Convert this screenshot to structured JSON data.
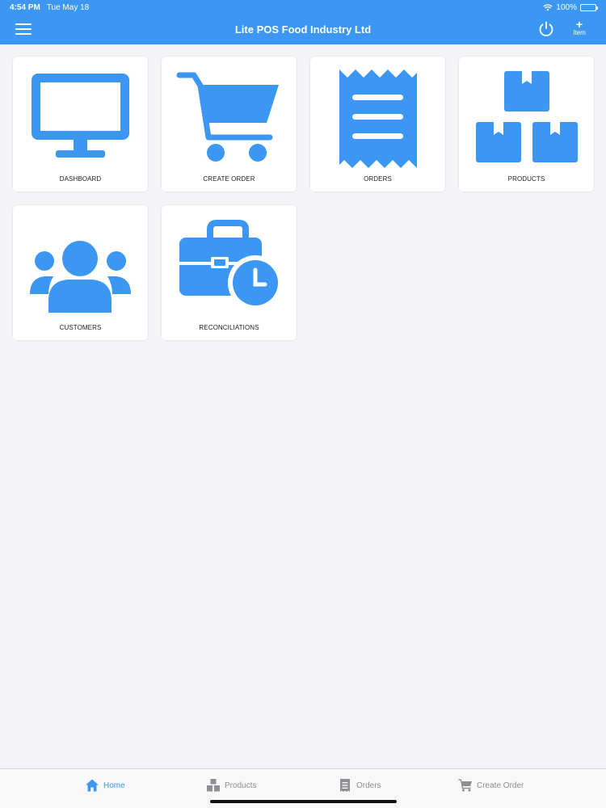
{
  "status_bar": {
    "time": "4:54 PM",
    "date": "Tue May 18",
    "battery": "100%"
  },
  "navbar": {
    "title": "Lite POS Food Industry Ltd",
    "add_item_label": "Item",
    "add_item_plus": "+"
  },
  "tiles": [
    {
      "label": "DASHBOARD",
      "icon": "monitor-icon"
    },
    {
      "label": "CREATE ORDER",
      "icon": "shopping-cart-icon"
    },
    {
      "label": "ORDERS",
      "icon": "receipt-icon"
    },
    {
      "label": "PRODUCTS",
      "icon": "boxes-icon"
    },
    {
      "label": "CUSTOMERS",
      "icon": "people-icon"
    },
    {
      "label": "RECONCILIATIONS",
      "icon": "briefcase-clock-icon"
    }
  ],
  "tabs": [
    {
      "label": "Home",
      "icon": "home-icon",
      "active": true
    },
    {
      "label": "Products",
      "icon": "boxes-icon",
      "active": false
    },
    {
      "label": "Orders",
      "icon": "receipt-icon",
      "active": false
    },
    {
      "label": "Create Order",
      "icon": "shopping-cart-icon",
      "active": false
    }
  ],
  "colors": {
    "accent": "#3b97f2",
    "tab_inactive": "#8e8e93",
    "background": "#f4f4f7"
  }
}
